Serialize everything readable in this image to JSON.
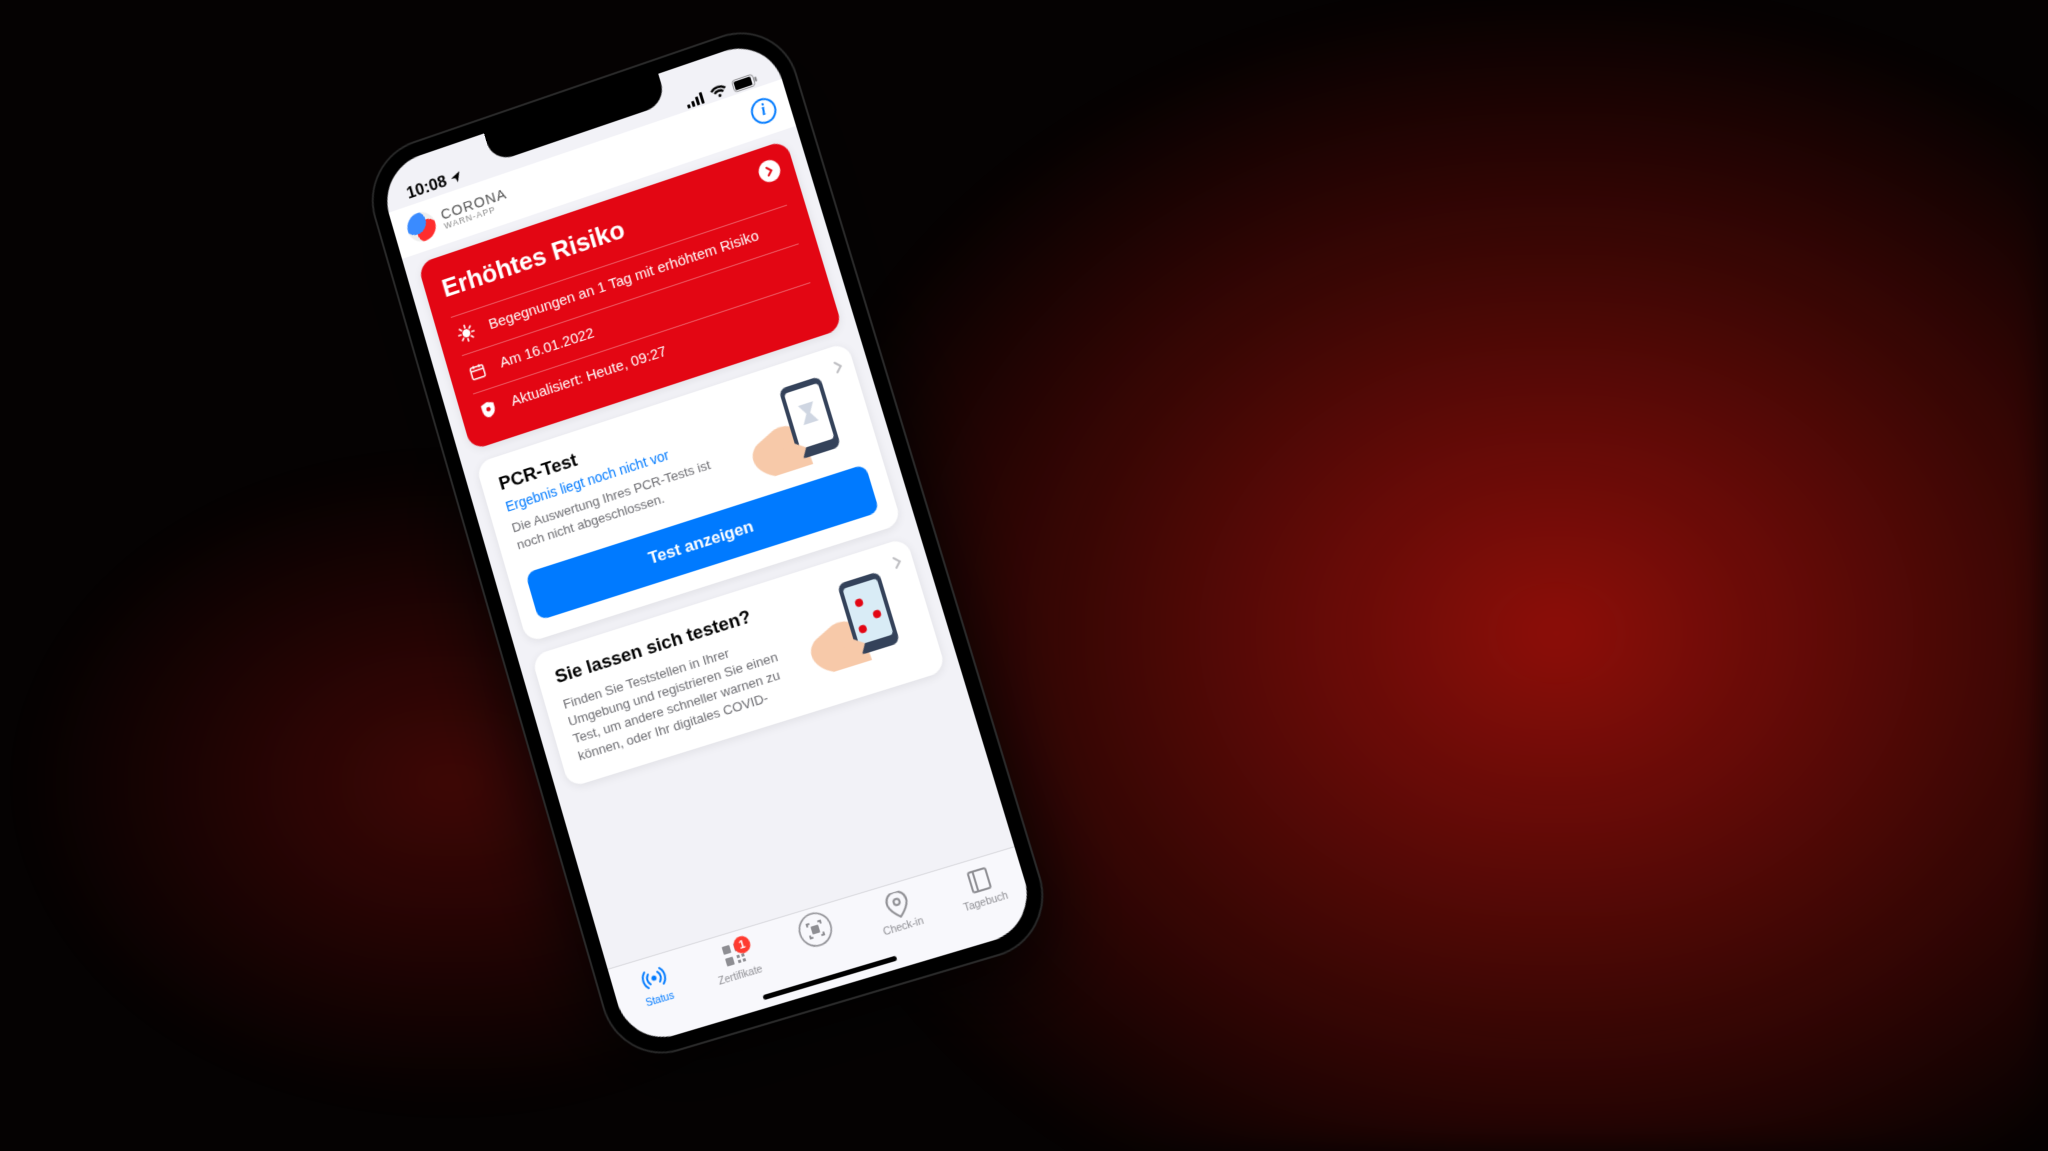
{
  "status_bar": {
    "time": "10:08"
  },
  "app": {
    "brand_line1": "CORONA",
    "brand_line2": "WARN-APP"
  },
  "risk": {
    "title": "Erhöhtes Risiko",
    "encounters": "Begegnungen an 1 Tag mit erhöhtem Risiko",
    "date": "Am 16.01.2022",
    "updated": "Aktualisiert: Heute, 09:27"
  },
  "pcr": {
    "title": "PCR-Test",
    "subtitle": "Ergebnis liegt noch nicht vor",
    "body": "Die Auswertung Ihres PCR-Tests ist noch nicht abgeschlossen.",
    "button": "Test anzeigen"
  },
  "find": {
    "title": "Sie lassen sich testen?",
    "body": "Finden Sie Teststellen in Ihrer Umgebung und registrieren Sie einen Test, um andere schneller warnen zu können, oder Ihr digitales COVID-"
  },
  "tabs": {
    "items": [
      {
        "label": "Status",
        "badge": null,
        "active": true
      },
      {
        "label": "Zertifikate",
        "badge": "1",
        "active": false
      },
      {
        "label": "",
        "badge": null,
        "active": false
      },
      {
        "label": "Check-in",
        "badge": null,
        "active": false
      },
      {
        "label": "Tagebuch",
        "badge": null,
        "active": false
      }
    ]
  },
  "colors": {
    "risk": "#e30613",
    "accent": "#007aff",
    "badge": "#ff3b30"
  }
}
